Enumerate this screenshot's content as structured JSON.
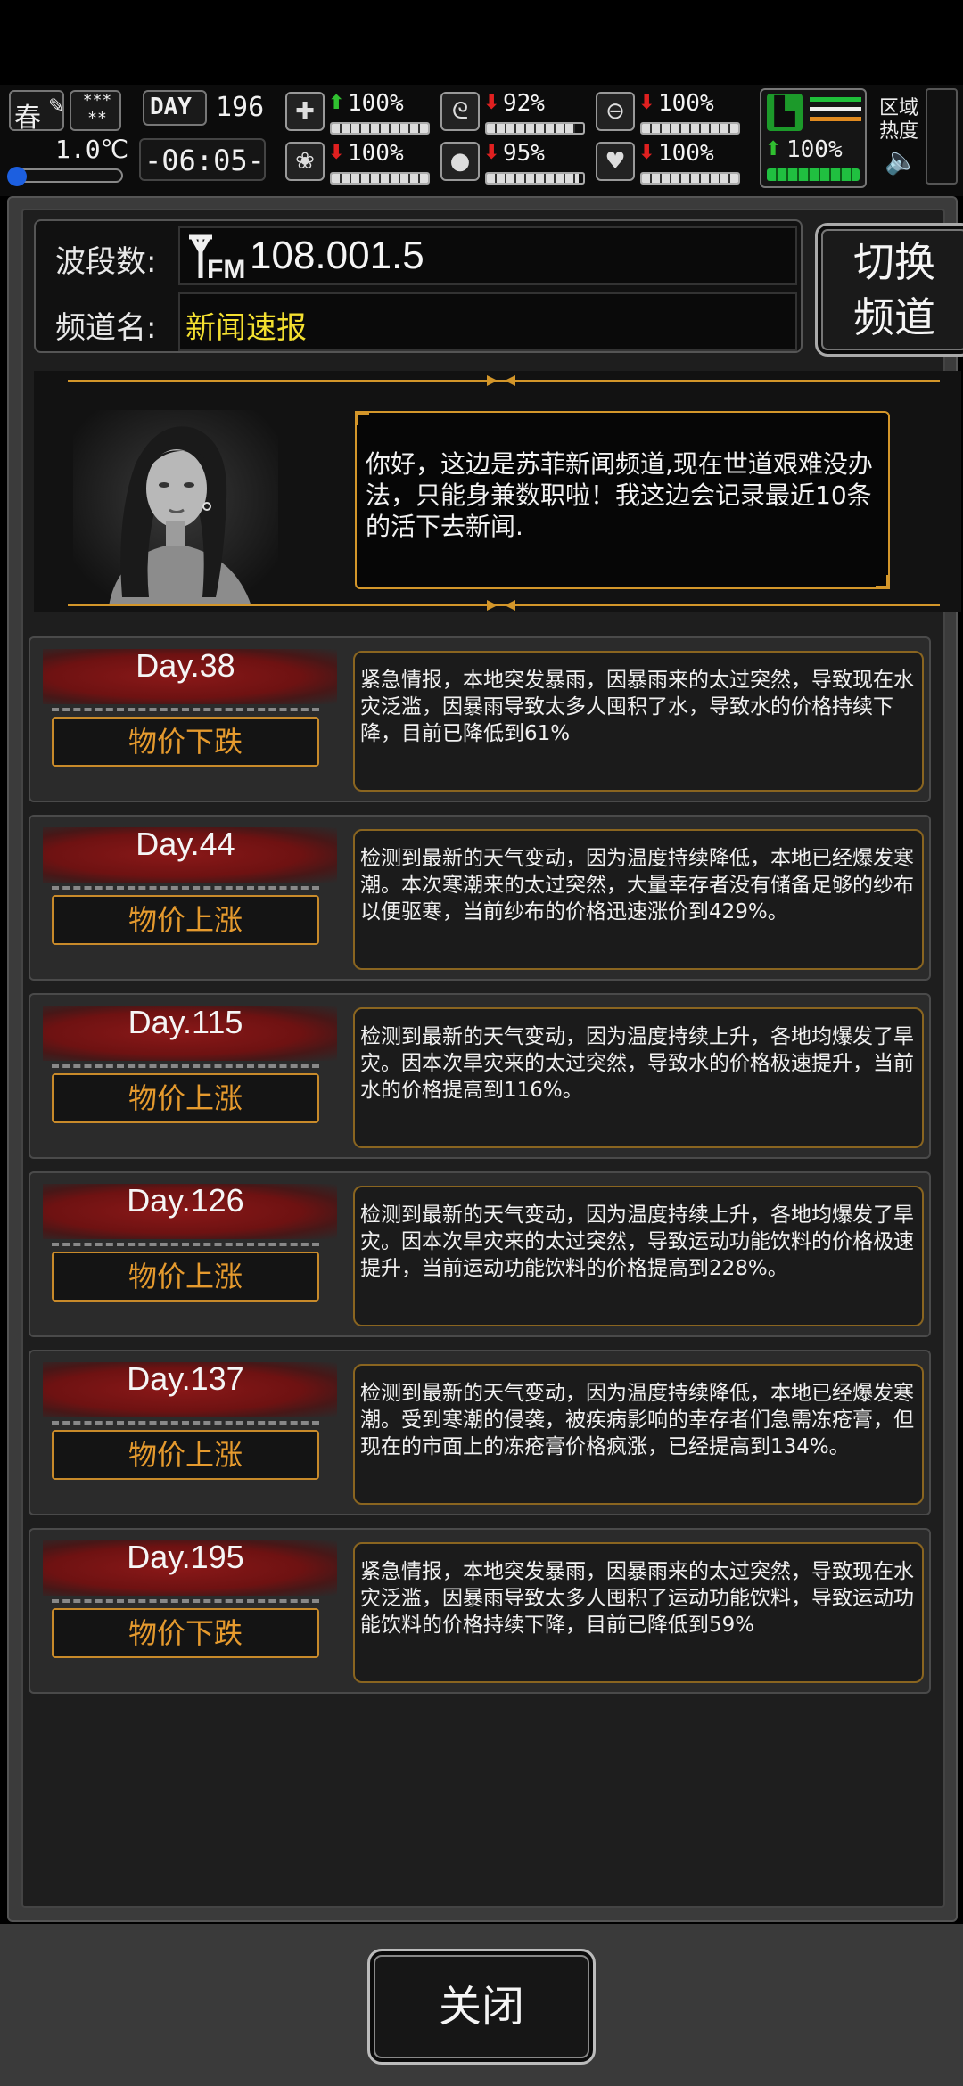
{
  "status": {
    "season": "春",
    "weather_icon": "snowflake-stars",
    "weather_text": "*** **",
    "temperature": "1.0℃",
    "temperature_level": 0.1,
    "day_label": "DAY",
    "day_number": "196",
    "time": "-06:05-",
    "stats": [
      {
        "name": "health",
        "icon": "medkit",
        "arrow": "up",
        "value": "100%",
        "level": 1.0
      },
      {
        "name": "hunger",
        "icon": "stomach",
        "arrow": "down",
        "value": "92%",
        "level": 0.92
      },
      {
        "name": "energy",
        "icon": "pill",
        "arrow": "down",
        "value": "100%",
        "level": 1.0
      },
      {
        "name": "sanity",
        "icon": "brain",
        "arrow": "down",
        "value": "100%",
        "level": 1.0
      },
      {
        "name": "thirst",
        "icon": "drop",
        "arrow": "down",
        "value": "95%",
        "level": 0.95
      },
      {
        "name": "mood",
        "icon": "heart",
        "arrow": "down",
        "value": "100%",
        "level": 1.0
      }
    ],
    "stamina": {
      "arrow": "up",
      "value": "100%",
      "level": 1.0
    },
    "region_heat_label": "区域\n热度"
  },
  "radio": {
    "band_label": "波段数:",
    "band_value": "108.001.5",
    "fm_text": "FM",
    "channel_label": "频道名:",
    "channel_value": "新闻速报",
    "switch_label_line1": "切换",
    "switch_label_line2": "频道"
  },
  "host": {
    "speech": "你好，这边是苏菲新闻频道,现在世道艰难没办法，只能身兼数职啦！我这边会记录最近10条的活下去新闻."
  },
  "news": [
    {
      "day": "Day.38",
      "tag": "物价下跌",
      "text": "紧急情报，本地突发暴雨，因暴雨来的太过突然，导致现在水灾泛滥，因暴雨导致太多人囤积了水，导致水的价格持续下降，目前已降低到61%"
    },
    {
      "day": "Day.44",
      "tag": "物价上涨",
      "text": "检测到最新的天气变动，因为温度持续降低，本地已经爆发寒潮。本次寒潮来的太过突然，大量幸存者没有储备足够的纱布以便驱寒，当前纱布的价格迅速涨价到429%。"
    },
    {
      "day": "Day.115",
      "tag": "物价上涨",
      "text": "检测到最新的天气变动，因为温度持续上升，各地均爆发了旱灾。因本次旱灾来的太过突然，导致水的价格极速提升，当前水的价格提高到116%。"
    },
    {
      "day": "Day.126",
      "tag": "物价上涨",
      "text": "检测到最新的天气变动，因为温度持续上升，各地均爆发了旱灾。因本次旱灾来的太过突然，导致运动功能饮料的价格极速提升，当前运动功能饮料的价格提高到228%。"
    },
    {
      "day": "Day.137",
      "tag": "物价上涨",
      "text": "检测到最新的天气变动，因为温度持续降低，本地已经爆发寒潮。受到寒潮的侵袭，被疾病影响的幸存者们急需冻疮膏，但现在的市面上的冻疮膏价格疯涨，已经提高到134%。"
    },
    {
      "day": "Day.195",
      "tag": "物价下跌",
      "text": "紧急情报，本地突发暴雨，因暴雨来的太过突然，导致现在水灾泛滥，因暴雨导致太多人囤积了运动功能饮料，导致运动功能饮料的价格持续下降，目前已降低到59%"
    }
  ],
  "close_label": "关闭",
  "colors": {
    "accent_gold": "#d3962a",
    "tag_orange": "#e59a2e",
    "channel_yellow": "#f4e030",
    "brush_red": "#8a1818"
  }
}
